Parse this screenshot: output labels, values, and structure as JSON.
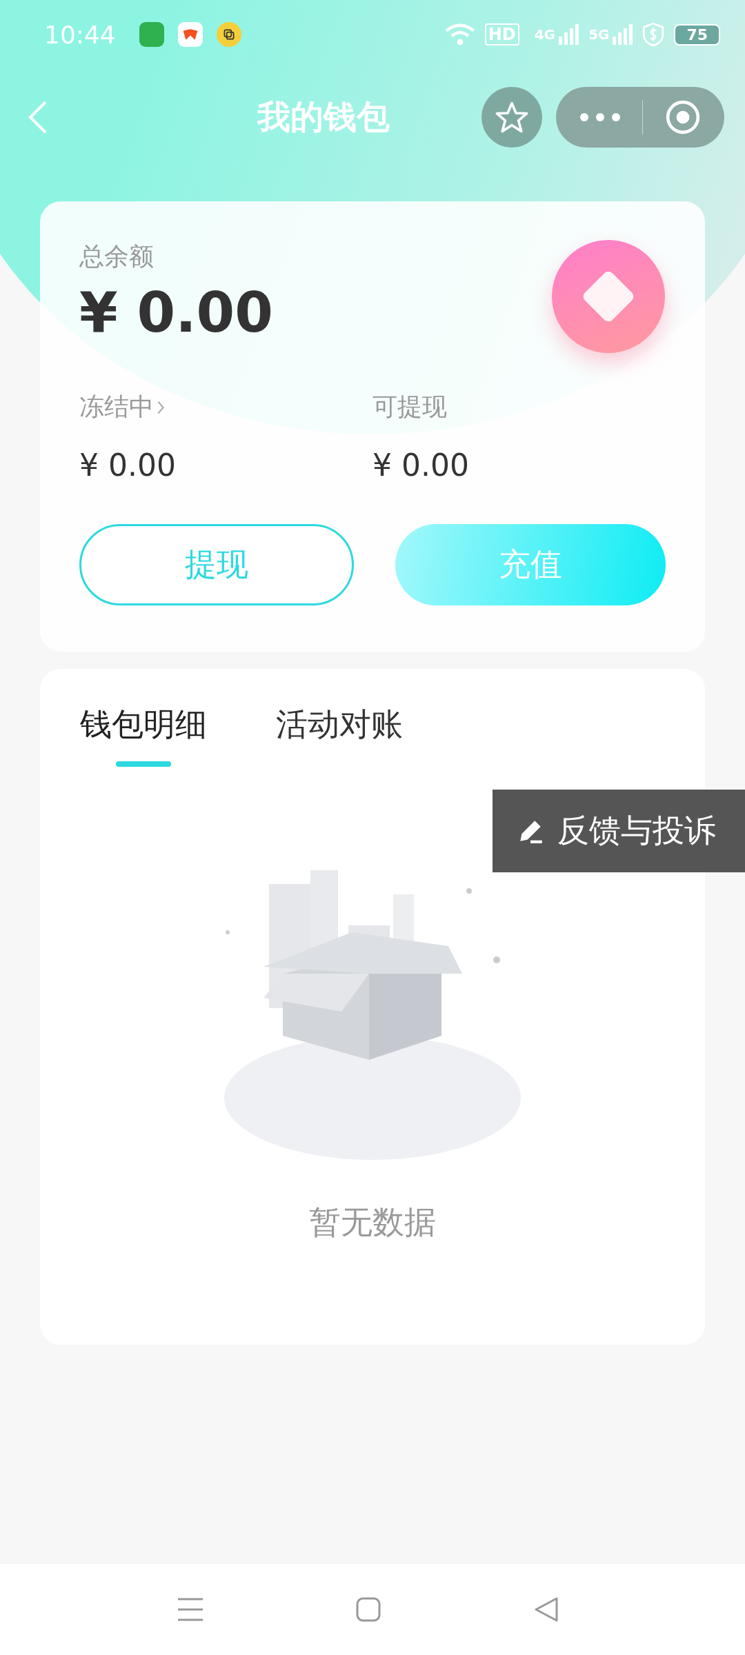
{
  "status_bar": {
    "time": "10:44",
    "indicators": [
      "HD",
      "4G",
      "5G"
    ],
    "battery": "75"
  },
  "header": {
    "title": "我的钱包"
  },
  "balance_card": {
    "total_label": "总余额",
    "total": "¥ 0.00",
    "frozen_label": "冻结中",
    "frozen": "¥ 0.00",
    "withdrawable_label": "可提现",
    "withdrawable": "¥ 0.00",
    "buttons": [
      {
        "label": "提现",
        "kind": "outline"
      },
      {
        "label": "充值",
        "kind": "filled"
      }
    ]
  },
  "tabs": [
    {
      "label": "钱包明细",
      "selected": true
    },
    {
      "label": "活动对账",
      "selected": false
    }
  ],
  "empty_state": "暂无数据",
  "feedback": "反馈与投诉"
}
